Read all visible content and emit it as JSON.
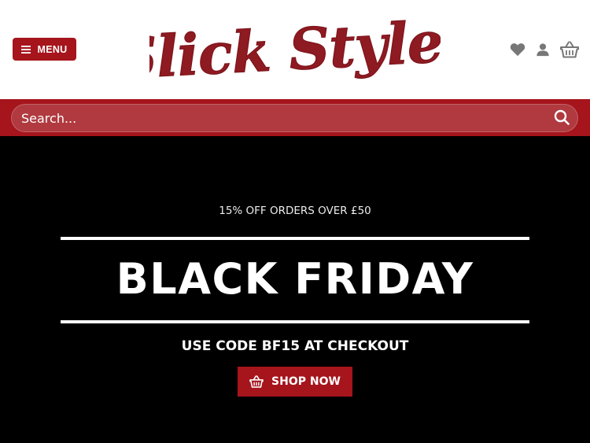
{
  "header": {
    "menu_label": "MENU",
    "logo_text": "Slick Styles",
    "icons": [
      "heart-icon",
      "user-icon",
      "basket-icon"
    ]
  },
  "search": {
    "placeholder": "Search..."
  },
  "banner": {
    "promo": "15% OFF ORDERS OVER £50",
    "headline": "BLACK FRIDAY",
    "code_prefix": "USE CODE ",
    "code": "BF15",
    "code_suffix": " AT CHECKOUT",
    "cta_label": "SHOP NOW"
  },
  "colors": {
    "brand_red": "#a6141c",
    "banner_bg": "#000000",
    "icon_gray": "#777777"
  }
}
